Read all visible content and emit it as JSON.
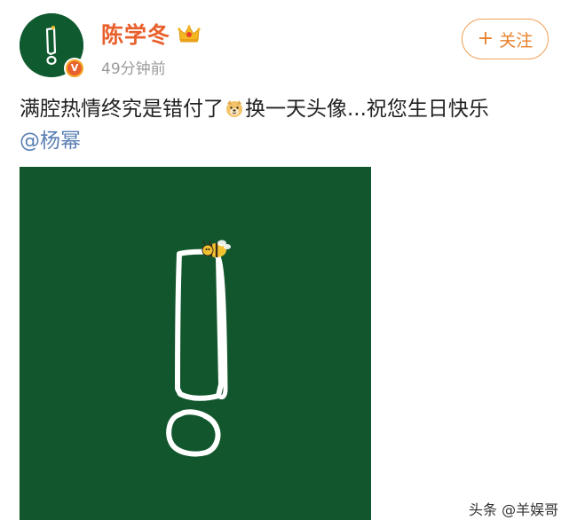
{
  "post": {
    "author": "陈学冬",
    "verified_badge": "V",
    "timestamp": "49分钟前",
    "follow_label": "关注",
    "follow_plus": "+",
    "text_before_emoji": "满腔热情终究是错付了",
    "text_after_emoji": "换一天头像...祝您生日快乐",
    "mention": "@杨幂",
    "emoji": "doge-emoji"
  },
  "watermark": {
    "text": "头条 @羊娱哥"
  },
  "colors": {
    "username": "#e8602c",
    "follow_border": "#f0a35c",
    "mention": "#5a7fb3",
    "image_bg": "#11562c",
    "timestamp": "#9b9b9b"
  },
  "icons": {
    "crown": "crown-icon",
    "badge": "verified-v-icon",
    "bee": "bee-icon",
    "exclamation": "exclamation-mark-graphic"
  }
}
